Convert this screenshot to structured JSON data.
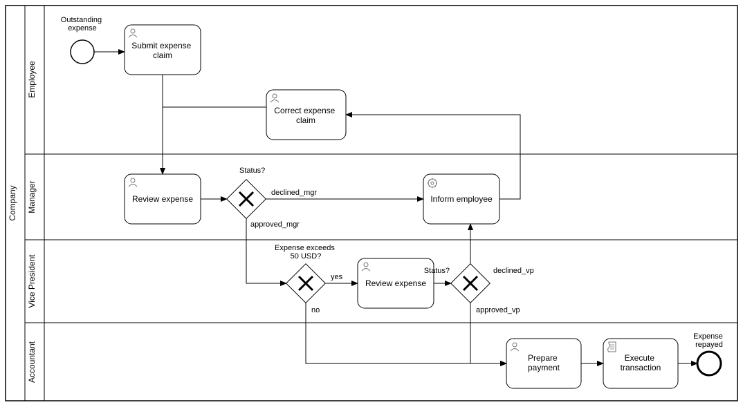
{
  "pool": {
    "name": "Company"
  },
  "lanes": {
    "employee": "Employee",
    "manager": "Manager",
    "vp": "Vice President",
    "accountant": "Accountant"
  },
  "tasks": {
    "submit": "Submit expense claim",
    "correct": "Correct expense claim",
    "review_mgr": "Review expense",
    "inform": "Inform employee",
    "review_vp": "Review expense",
    "prepare": "Prepare payment",
    "execute": "Execute transaction"
  },
  "events": {
    "start": "Outstanding expense",
    "end": "Expense repayed"
  },
  "gateways": {
    "g1_label": "Status?",
    "g1_out1": "declined_mgr",
    "g1_out2": "approved_mgr",
    "g2_label": "Expense exceeds 50 USD?",
    "g2_yes": "yes",
    "g2_no": "no",
    "g3_label": "Status?",
    "g3_out1": "declined_vp",
    "g3_out2": "approved_vp"
  }
}
